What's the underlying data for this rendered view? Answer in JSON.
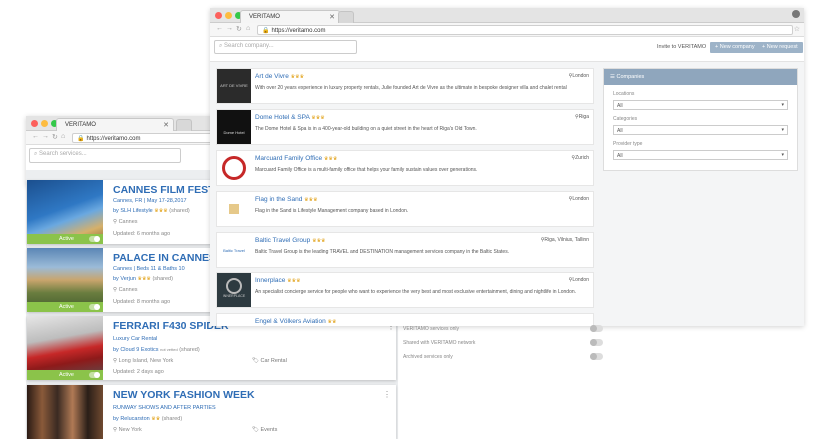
{
  "back_window": {
    "tab_title": "VERITAMO",
    "url": "https://veritamo.com",
    "search_placeholder": "Search services...",
    "cards": [
      {
        "title": "CANNES FILM FESTIVA",
        "line1": "Cannes, FR | May 17-28,2017",
        "by": "by SLH Lifestyle",
        "shared": "(shared)",
        "location": "Cannes",
        "updated": "Updated: 6 months ago",
        "status": "Active"
      },
      {
        "title": "PALACE IN CANNES",
        "line1": "Cannes | Beds 11 & Baths 10",
        "by": "by Verjun",
        "shared": "(shared)",
        "location": "Cannes",
        "updated": "Updated: 8 months ago",
        "status": "Active"
      },
      {
        "title": "FERRARI F430 SPIDER",
        "line1": "Luxury Car Rental",
        "by": "by Cloud 9 Exotics",
        "verified": "not vetted",
        "shared": "(shared)",
        "location": "Long Island, New York",
        "category": "Car Rental",
        "updated": "Updated: 2 days ago",
        "status": "Active"
      },
      {
        "title": "NEW YORK FASHION WEEK",
        "line1": "RUNWAY SHOWS AND AFTER PARTIES",
        "by": "by Relucarston",
        "shared": "(shared)",
        "location": "New York",
        "category": "Events"
      }
    ]
  },
  "front_window": {
    "tab_title": "VERITAMO",
    "url": "https://veritamo.com",
    "search_placeholder": "Search company...",
    "invite_label": "Invite to VERITAMO",
    "new_company_label": "+ New company",
    "new_request_label": "+ New request",
    "companies": [
      {
        "name": "Art de Vivre",
        "desc": "With over 20 years experience in luxury property rentals, Julie founded Art de Vivre as the ultimate in bespoke designer villa and chalet rental",
        "location": "London",
        "logo_text": "ART DE VIVRE"
      },
      {
        "name": "Dome Hotel & SPA",
        "desc": "The Dome Hotel & Spa is in a 400-year-old building on a quiet street in the heart of Riga's Old Town.",
        "location": "Riga",
        "logo_text": "Dome Hotel"
      },
      {
        "name": "Marcuard Family Office",
        "desc": "Marcuard Family Office is a multi-family office that helps your family sustain values over generations.",
        "location": "Zurich",
        "logo_text": ""
      },
      {
        "name": "Flag in the Sand",
        "desc": "Flag in the Sand is Lifestyle Management company based in London.",
        "location": "London",
        "logo_text": ""
      },
      {
        "name": "Baltic Travel Group",
        "desc": "Baltic Travel Group is the leading TRAVEL and DESTINATION management services company in the Baltic States.",
        "location": "Riga, Vilnius, Tallinn",
        "logo_text": "Baltic Travel"
      },
      {
        "name": "Innerplace",
        "desc": "An specialist concierge service for people who want to experience the very best and most exclusive entertainment, dining and nightlife in London.",
        "location": "London",
        "logo_text": "INNERPLACE"
      },
      {
        "name": "Engel & Völkers Aviation",
        "desc": "",
        "location": "",
        "logo_text": ""
      }
    ],
    "panel": {
      "title": "Companies",
      "location_label": "Locations",
      "location_value": "All",
      "categories_label": "Categories",
      "categories_value": "All",
      "provider_label": "Provider type",
      "provider_value": "All"
    },
    "switches": [
      "VERITAMO services only",
      "Shared with VERITAMO network",
      "Archived services only"
    ]
  },
  "colors": {
    "accent": "#2f6db5",
    "active": "#8bc34a",
    "panel_header": "#8fa6bd",
    "button": "#9db3c8"
  }
}
